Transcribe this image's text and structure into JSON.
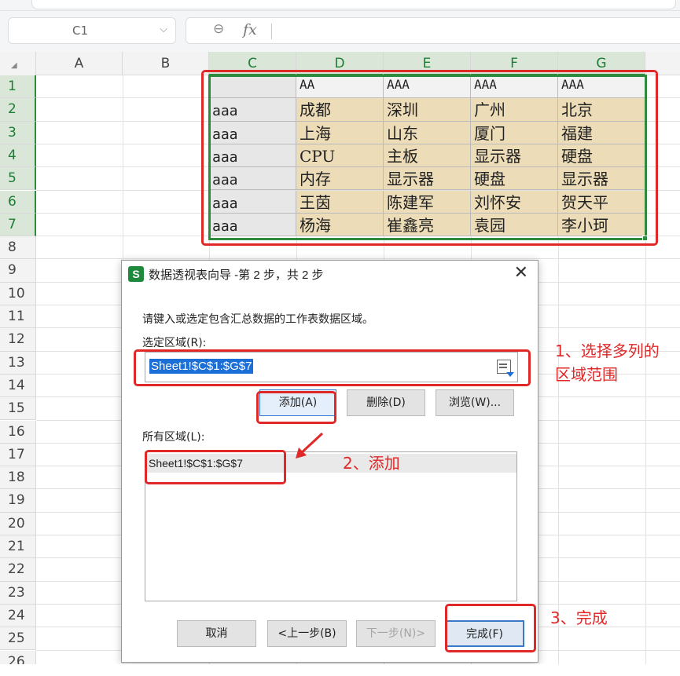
{
  "formula_bar": {
    "cell_ref": "C1",
    "fx_label": "fx"
  },
  "columns": [
    "A",
    "B",
    "C",
    "D",
    "E",
    "F",
    "G"
  ],
  "selected_columns": [
    "C",
    "D",
    "E",
    "F",
    "G"
  ],
  "rows": [
    "1",
    "2",
    "3",
    "4",
    "5",
    "6",
    "7",
    "8",
    "9",
    "10",
    "11",
    "12",
    "13",
    "14",
    "15",
    "16",
    "17",
    "18",
    "19",
    "20",
    "21",
    "22",
    "23",
    "24",
    "25",
    "26"
  ],
  "sheet_data": {
    "header": [
      "",
      "AA",
      "AAA",
      "AAA",
      "AAA"
    ],
    "body": [
      [
        "aaa",
        "成都",
        "深圳",
        "广州",
        "北京"
      ],
      [
        "aaa",
        "上海",
        "山东",
        "厦门",
        "福建"
      ],
      [
        "aaa",
        "CPU",
        "主板",
        "显示器",
        "硬盘"
      ],
      [
        "aaa",
        "内存",
        "显示器",
        "硬盘",
        "显示器"
      ],
      [
        "aaa",
        "王茵",
        "陈建军",
        "刘怀安",
        "贺天平"
      ],
      [
        "aaa",
        "杨海",
        "崔鑫亮",
        "袁园",
        "李小珂"
      ]
    ]
  },
  "dialog": {
    "app_icon": "S",
    "title": "数据透视表向导 -第 2 步，共 2 步",
    "close": "✕",
    "prompt": "请键入或选定包含汇总数据的工作表数据区域。",
    "select_range_label": "选定区域(R):",
    "select_range_value": "Sheet1!$C$1:$G$7",
    "add_button": "添加(A)",
    "delete_button": "删除(D)",
    "browse_button": "浏览(W)...",
    "all_ranges_label": "所有区域(L):",
    "all_ranges_items": [
      "Sheet1!$C$1:$G$7"
    ],
    "cancel_button": "取消",
    "prev_button": "<上一步(B)",
    "next_button": "下一步(N)>",
    "finish_button": "完成(F)"
  },
  "annotations": {
    "step1_line1": "1、选择多列的",
    "step1_line2": "区域范围",
    "step2": "2、添加",
    "step3": "3、完成"
  },
  "colors": {
    "selection_green": "#2e8b3e",
    "annotation_red": "#e02828",
    "cell_tan": "#ecdcb8",
    "highlight_blue": "#1d6fd8"
  }
}
